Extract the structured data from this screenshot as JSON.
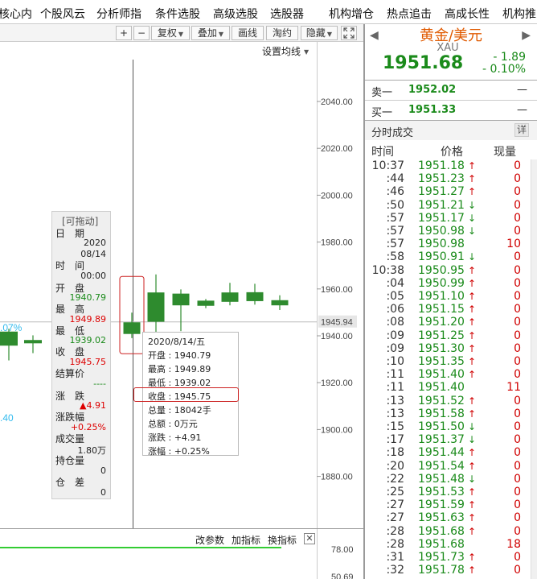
{
  "top_menu": [
    "核心内",
    "个股风云",
    "分析师指",
    "条件选股",
    "高级选股",
    "选股器",
    "机构增仓",
    "热点追击",
    "高成长性",
    "机构推"
  ],
  "toolbar": {
    "plus": "+",
    "minus": "−",
    "fuquan": "复权",
    "diejia": "叠加",
    "huaxian": "画线",
    "taoyue": "淘约",
    "hide": "隐藏"
  },
  "chart": {
    "ma_settings": "设置均线",
    "y_ticks": [
      "2040.00",
      "2020.00",
      "2000.00",
      "1980.00",
      "1960.00",
      "1945.94",
      "1940.00",
      "1920.00",
      "1900.00",
      "1880.00"
    ],
    "current_price_label": "1945.94",
    "left_labels": [
      ".07%",
      ".40"
    ],
    "candles": [
      {
        "open": 1935.8,
        "close": 1941.8,
        "high": 1943.0,
        "low": 1929.5
      },
      {
        "open": 1936.8,
        "close": 1938.2,
        "high": 1940.2,
        "low": 1932.6
      },
      {
        "open": 1940.79,
        "close": 1945.75,
        "high": 1949.89,
        "low": 1939.02
      },
      {
        "open": 1946.0,
        "close": 1958.5,
        "high": 1966.2,
        "low": 1940.5
      },
      {
        "open": 1953.0,
        "close": 1958.0,
        "high": 1959.8,
        "low": 1942.0
      },
      {
        "open": 1952.8,
        "close": 1955.0,
        "high": 1955.7,
        "low": 1951.8
      },
      {
        "open": 1954.5,
        "close": 1958.5,
        "high": 1962.6,
        "low": 1953.0
      },
      {
        "open": 1954.8,
        "close": 1958.6,
        "high": 1962.2,
        "low": 1953.3
      },
      {
        "open": 1953.0,
        "close": 1955.2,
        "high": 1957.3,
        "low": 1951.0
      }
    ],
    "indicator_buttons": [
      "改参数",
      "加指标",
      "换指标"
    ],
    "indicator_ticks": [
      "78.00",
      "50.69"
    ]
  },
  "info_panel": {
    "header": "[可拖动]",
    "date_label": "日　期",
    "date_year": "2020",
    "date_md": "08/14",
    "time_label": "时　间",
    "time_value": "00:00",
    "open_label": "开　盘",
    "open_value": "1940.79",
    "high_label": "最　高",
    "high_value": "1949.89",
    "low_label": "最　低",
    "low_value": "1939.02",
    "close_label": "收　盘",
    "close_value": "1945.75",
    "settle_label": "结算价",
    "settle_value": "----",
    "change_label": "涨　跌",
    "change_value": "▲4.91",
    "changepct_label": "涨跌幅",
    "changepct_value": "+0.25%",
    "volume_label": "成交量",
    "volume_value": "1.80万",
    "oi_label": "持仓量",
    "oi_value": "0",
    "diff_label": "仓　差",
    "diff_value": "0"
  },
  "tooltip": {
    "date": "2020/8/14/五",
    "rows": [
      {
        "label": "开盘",
        "value": "1940.79"
      },
      {
        "label": "最高",
        "value": "1949.89"
      },
      {
        "label": "最低",
        "value": "1939.02"
      },
      {
        "label": "收盘",
        "value": "1945.75"
      },
      {
        "label": "总量",
        "value": "18042手"
      },
      {
        "label": "总额",
        "value": "0万元"
      },
      {
        "label": "涨跌",
        "value": "+4.91"
      },
      {
        "label": "涨幅",
        "value": "+0.25%"
      }
    ]
  },
  "quote": {
    "name": "黄金/美元",
    "code": "XAU",
    "price": "1951.68",
    "change": "- 1.89",
    "change_pct": "- 0.10%",
    "sell1_label": "卖一",
    "sell1_price": "1952.02",
    "sell1_vol": "—",
    "buy1_label": "买一",
    "buy1_price": "1951.33",
    "buy1_vol": "—",
    "ticks_title": "分时成交",
    "ticks_detail": "详",
    "col_time": "时间",
    "col_price": "价格",
    "col_vol": "现量",
    "nav_left": "◀",
    "nav_right": "▶"
  },
  "ticks": [
    {
      "time": "10:37",
      "price": "1951.18",
      "dir": "up",
      "vol": "0"
    },
    {
      "time": ":44",
      "price": "1951.23",
      "dir": "up",
      "vol": "0"
    },
    {
      "time": ":46",
      "price": "1951.27",
      "dir": "up",
      "vol": "0"
    },
    {
      "time": ":50",
      "price": "1951.21",
      "dir": "down",
      "vol": "0"
    },
    {
      "time": ":57",
      "price": "1951.17",
      "dir": "down",
      "vol": "0"
    },
    {
      "time": ":57",
      "price": "1950.98",
      "dir": "down",
      "vol": "0"
    },
    {
      "time": ":57",
      "price": "1950.98",
      "dir": "none",
      "vol": "10"
    },
    {
      "time": ":58",
      "price": "1950.91",
      "dir": "down",
      "vol": "0"
    },
    {
      "time": "10:38",
      "price": "1950.95",
      "dir": "up",
      "vol": "0"
    },
    {
      "time": ":04",
      "price": "1950.99",
      "dir": "up",
      "vol": "0"
    },
    {
      "time": ":05",
      "price": "1951.10",
      "dir": "up",
      "vol": "0"
    },
    {
      "time": ":06",
      "price": "1951.15",
      "dir": "up",
      "vol": "0"
    },
    {
      "time": ":08",
      "price": "1951.20",
      "dir": "up",
      "vol": "0"
    },
    {
      "time": ":09",
      "price": "1951.25",
      "dir": "up",
      "vol": "0"
    },
    {
      "time": ":09",
      "price": "1951.30",
      "dir": "up",
      "vol": "0"
    },
    {
      "time": ":10",
      "price": "1951.35",
      "dir": "up",
      "vol": "0"
    },
    {
      "time": ":11",
      "price": "1951.40",
      "dir": "up",
      "vol": "0"
    },
    {
      "time": ":11",
      "price": "1951.40",
      "dir": "none",
      "vol": "11"
    },
    {
      "time": ":13",
      "price": "1951.52",
      "dir": "up",
      "vol": "0"
    },
    {
      "time": ":13",
      "price": "1951.58",
      "dir": "up",
      "vol": "0"
    },
    {
      "time": ":15",
      "price": "1951.50",
      "dir": "down",
      "vol": "0"
    },
    {
      "time": ":17",
      "price": "1951.37",
      "dir": "down",
      "vol": "0"
    },
    {
      "time": ":18",
      "price": "1951.44",
      "dir": "up",
      "vol": "0"
    },
    {
      "time": ":20",
      "price": "1951.54",
      "dir": "up",
      "vol": "0"
    },
    {
      "time": ":22",
      "price": "1951.48",
      "dir": "down",
      "vol": "0"
    },
    {
      "time": ":25",
      "price": "1951.53",
      "dir": "up",
      "vol": "0"
    },
    {
      "time": ":27",
      "price": "1951.59",
      "dir": "up",
      "vol": "0"
    },
    {
      "time": ":27",
      "price": "1951.63",
      "dir": "up",
      "vol": "0"
    },
    {
      "time": ":28",
      "price": "1951.68",
      "dir": "up",
      "vol": "0"
    },
    {
      "time": ":28",
      "price": "1951.68",
      "dir": "none",
      "vol": "18"
    },
    {
      "time": ":31",
      "price": "1951.73",
      "dir": "up",
      "vol": "0"
    },
    {
      "time": ":32",
      "price": "1951.78",
      "dir": "up",
      "vol": "0"
    }
  ],
  "colors": {
    "up": "#d00000",
    "down": "#1a8a1a",
    "candle_up": "#2e8b2e",
    "quote_name": "#e05a00",
    "highlight_box": "#cc2222",
    "ma_line": "#33cc33"
  }
}
